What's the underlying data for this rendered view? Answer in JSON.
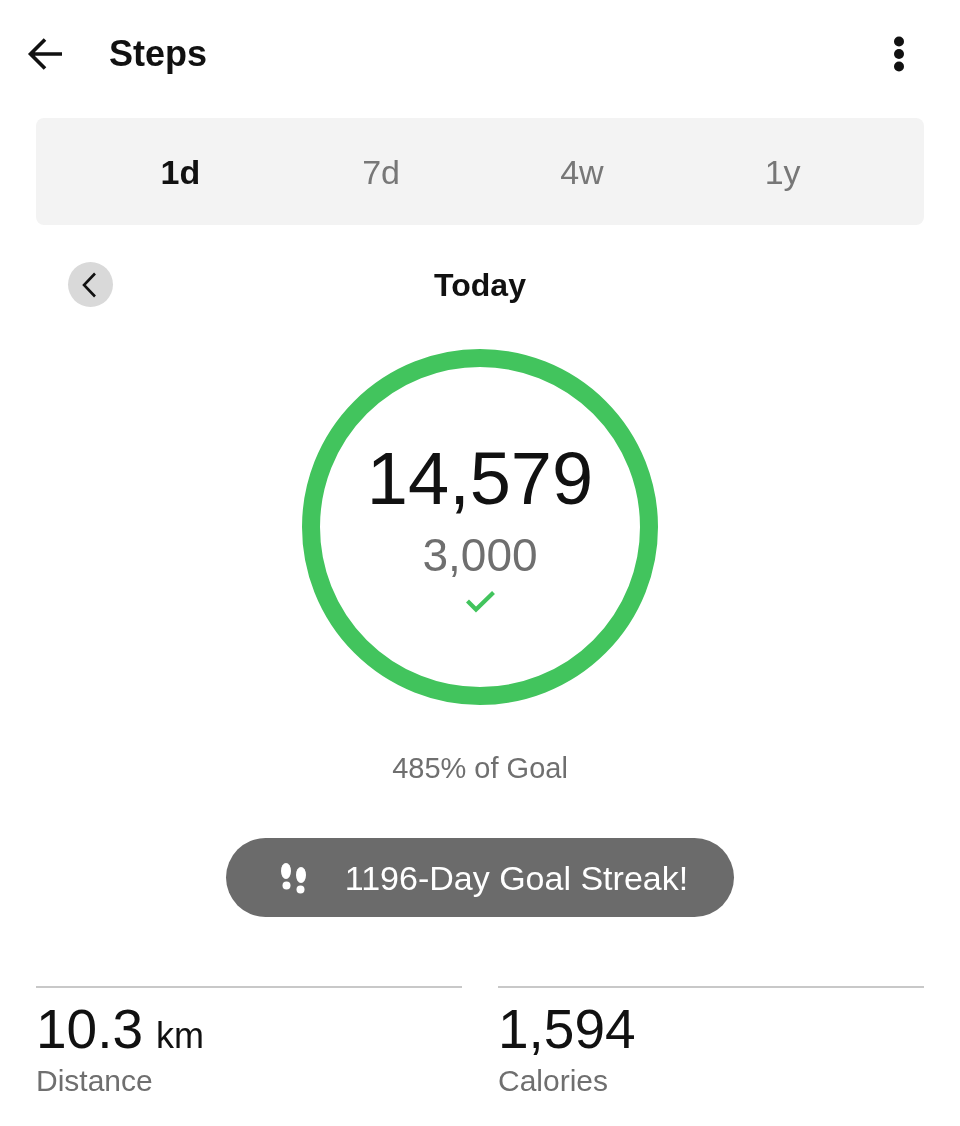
{
  "header": {
    "title": "Steps"
  },
  "tabs": [
    {
      "label": "1d",
      "selected": true
    },
    {
      "label": "7d",
      "selected": false
    },
    {
      "label": "4w",
      "selected": false
    },
    {
      "label": "1y",
      "selected": false
    }
  ],
  "period": {
    "label": "Today"
  },
  "goal_ring": {
    "steps": "14,579",
    "goal": "3,000",
    "level": 1,
    "goal_met": true
  },
  "goal_percent": "485% of Goal",
  "streak": {
    "label": "1196-Day Goal Streak!"
  },
  "stats": [
    {
      "value": "10.3",
      "unit": "km",
      "label": "Distance"
    },
    {
      "value": "1,594",
      "label": "Calories"
    }
  ]
}
